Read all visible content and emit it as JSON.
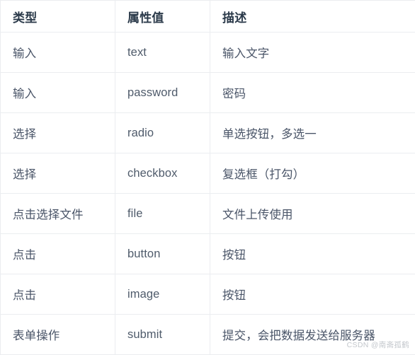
{
  "table": {
    "columns": [
      {
        "key": "type",
        "label": "类型"
      },
      {
        "key": "value",
        "label": "属性值"
      },
      {
        "key": "desc",
        "label": "描述"
      }
    ],
    "rows": [
      {
        "type": "输入",
        "value": "text",
        "desc": "输入文字"
      },
      {
        "type": "输入",
        "value": "password",
        "desc": "密码"
      },
      {
        "type": "选择",
        "value": "radio",
        "desc": "单选按钮，多选一"
      },
      {
        "type": "选择",
        "value": "checkbox",
        "desc": "复选框（打勾）"
      },
      {
        "type": "点击选择文件",
        "value": "file",
        "desc": "文件上传使用"
      },
      {
        "type": "点击",
        "value": "button",
        "desc": "按钮"
      },
      {
        "type": "点击",
        "value": "image",
        "desc": "按钮"
      },
      {
        "type": "表单操作",
        "value": "submit",
        "desc": "提交，会把数据发送给服务器"
      }
    ]
  },
  "watermark": {
    "text": "CSDN @南斋孤鹤"
  },
  "colors": {
    "border": "#ebedf0",
    "header_text": "#2b3a4a",
    "body_text": "#4a5568",
    "watermark_text": "#c3c7cc",
    "background": "#ffffff"
  }
}
